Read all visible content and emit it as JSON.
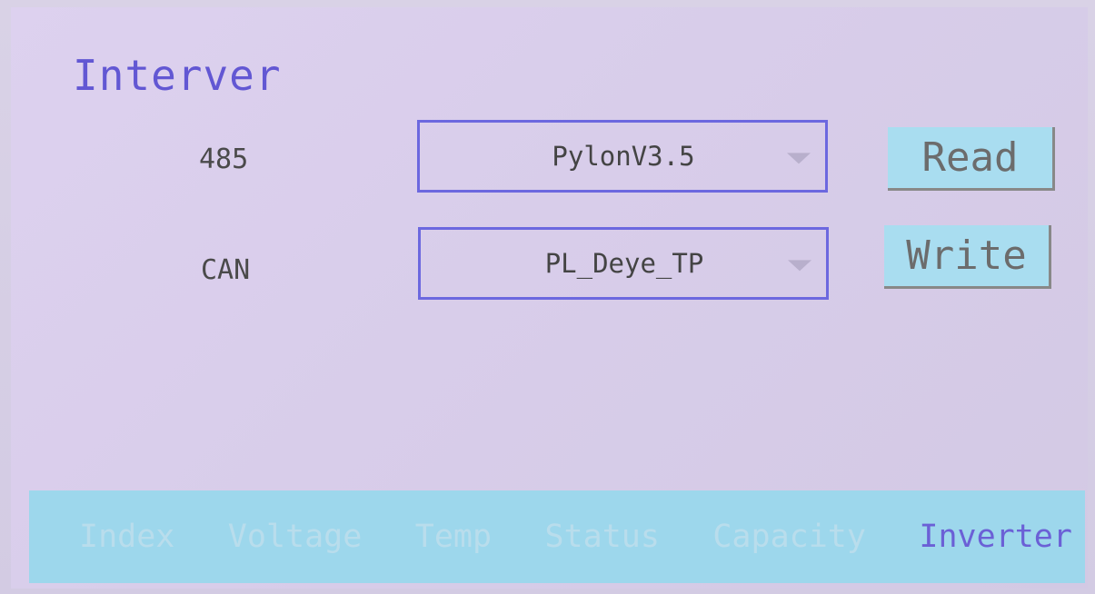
{
  "title": "Interver",
  "rows": [
    {
      "label": "485",
      "value": "PylonV3.5"
    },
    {
      "label": "CAN",
      "value": "PL_Deye_TP"
    }
  ],
  "buttons": {
    "read": "Read",
    "write": "Write"
  },
  "tabs": [
    {
      "label": "Index",
      "active": false
    },
    {
      "label": "Voltage",
      "active": false
    },
    {
      "label": "Temp",
      "active": false
    },
    {
      "label": "Status",
      "active": false
    },
    {
      "label": "Capacity",
      "active": false
    },
    {
      "label": "Inverter",
      "active": true
    }
  ],
  "colors": {
    "title": "#6257d3",
    "select_border": "#6c68df",
    "button_bg": "#a9ddf0",
    "tab_bar_bg": "#9dd7ec",
    "active_tab": "#6b60d6"
  },
  "icons": {
    "dropdown_arrow": "triangle-down"
  }
}
